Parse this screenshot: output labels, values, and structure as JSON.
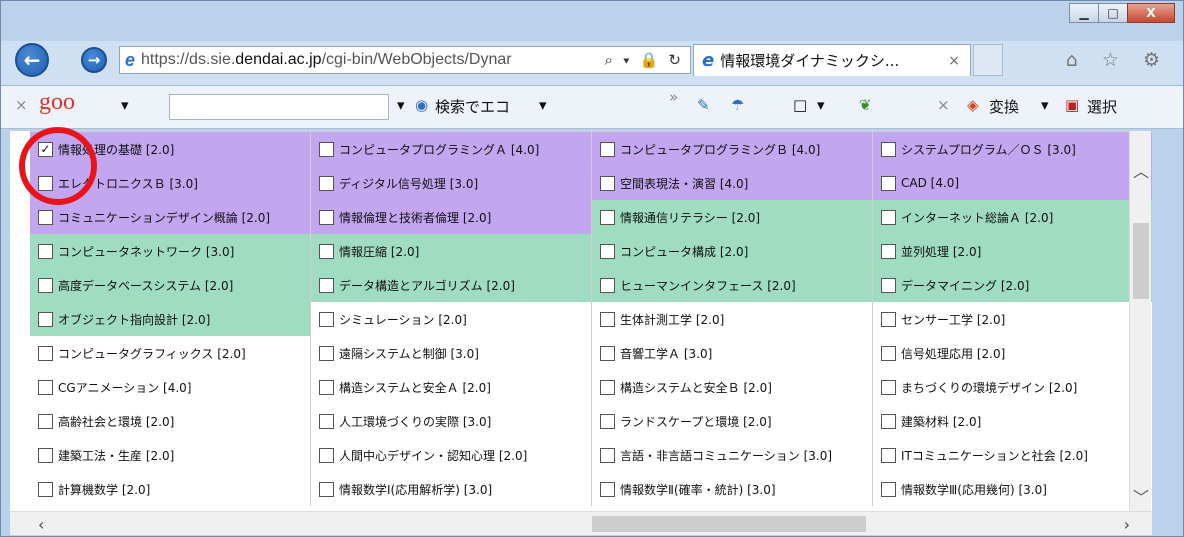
{
  "window": {
    "controls": {
      "minimize": "▁",
      "maximize": "□",
      "close": "X"
    }
  },
  "browser": {
    "address_prefix": "https://ds.sie.",
    "address_host": "dendai.ac.jp",
    "address_rest": "/cgi-bin/WebObjects/Dynar",
    "address_tools": "⌕ ▾ 🔒 ↻",
    "tab_title": "情報環境ダイナミックシ...",
    "tab_close": "×",
    "right_icons": "⌂ ☆ ⚙"
  },
  "toolbar": {
    "goo_close": "×",
    "goo_label": "goo",
    "goo_dropdown": "▾",
    "search_dropdown": "▾",
    "eco_label": "検索でエコ",
    "eco_dropdown": "▾",
    "overflow": "»",
    "page_icon_dropdown": "▾",
    "convert_close": "×",
    "convert_label": "変換",
    "convert_dropdown": "▾",
    "select_label": "選択"
  },
  "courses": {
    "rows": [
      [
        {
          "label": "情報処理の基礎 [2.0]",
          "color": "#c2a6f0",
          "checked": true
        },
        {
          "label": "コンピュータプログラミングＡ [4.0]",
          "color": "#c2a6f0",
          "checked": false
        },
        {
          "label": "コンピュータプログラミングＢ [4.0]",
          "color": "#c2a6f0",
          "checked": false
        },
        {
          "label": "システムプログラム／ＯＳ [3.0]",
          "color": "#c2a6f0",
          "checked": false
        }
      ],
      [
        {
          "label": "エレクトロニクスＢ [3.0]",
          "color": "#c2a6f0",
          "checked": false
        },
        {
          "label": "ディジタル信号処理 [3.0]",
          "color": "#c2a6f0",
          "checked": false
        },
        {
          "label": "空間表現法・演習 [4.0]",
          "color": "#c2a6f0",
          "checked": false
        },
        {
          "label": "CAD [4.0]",
          "color": "#c2a6f0",
          "checked": false
        }
      ],
      [
        {
          "label": "コミュニケーションデザイン概論 [2.0]",
          "color": "#c2a6f0",
          "checked": false
        },
        {
          "label": "情報倫理と技術者倫理 [2.0]",
          "color": "#c2a6f0",
          "checked": false
        },
        {
          "label": "情報通信リテラシー [2.0]",
          "color": "#9fdcc1",
          "checked": false
        },
        {
          "label": "インターネット総論Ａ [2.0]",
          "color": "#9fdcc1",
          "checked": false
        }
      ],
      [
        {
          "label": "コンピュータネットワーク [3.0]",
          "color": "#9fdcc1",
          "checked": false
        },
        {
          "label": "情報圧縮 [2.0]",
          "color": "#9fdcc1",
          "checked": false
        },
        {
          "label": "コンピュータ構成 [2.0]",
          "color": "#9fdcc1",
          "checked": false
        },
        {
          "label": "並列処理 [2.0]",
          "color": "#9fdcc1",
          "checked": false
        }
      ],
      [
        {
          "label": "高度データベースシステム [2.0]",
          "color": "#9fdcc1",
          "checked": false
        },
        {
          "label": "データ構造とアルゴリズム [2.0]",
          "color": "#9fdcc1",
          "checked": false
        },
        {
          "label": "ヒューマンインタフェース [2.0]",
          "color": "#9fdcc1",
          "checked": false
        },
        {
          "label": "データマイニング [2.0]",
          "color": "#9fdcc1",
          "checked": false
        }
      ],
      [
        {
          "label": "オブジェクト指向設計 [2.0]",
          "color": "#9fdcc1",
          "checked": false
        },
        {
          "label": "シミュレーション [2.0]",
          "color": "#ffffff",
          "checked": false
        },
        {
          "label": "生体計測工学 [2.0]",
          "color": "#ffffff",
          "checked": false
        },
        {
          "label": "センサー工学 [2.0]",
          "color": "#ffffff",
          "checked": false
        }
      ],
      [
        {
          "label": "コンピュータグラフィックス [2.0]",
          "color": "#ffffff",
          "checked": false
        },
        {
          "label": "遠隔システムと制御 [3.0]",
          "color": "#ffffff",
          "checked": false
        },
        {
          "label": "音響工学Ａ [3.0]",
          "color": "#ffffff",
          "checked": false
        },
        {
          "label": "信号処理応用 [2.0]",
          "color": "#ffffff",
          "checked": false
        }
      ],
      [
        {
          "label": "CGアニメーション [4.0]",
          "color": "#ffffff",
          "checked": false
        },
        {
          "label": "構造システムと安全Ａ [2.0]",
          "color": "#ffffff",
          "checked": false
        },
        {
          "label": "構造システムと安全Ｂ [2.0]",
          "color": "#ffffff",
          "checked": false
        },
        {
          "label": "まちづくりの環境デザイン [2.0]",
          "color": "#ffffff",
          "checked": false
        }
      ],
      [
        {
          "label": "高齢社会と環境 [2.0]",
          "color": "#ffffff",
          "checked": false
        },
        {
          "label": "人工環境づくりの実際 [3.0]",
          "color": "#ffffff",
          "checked": false
        },
        {
          "label": "ランドスケープと環境 [2.0]",
          "color": "#ffffff",
          "checked": false
        },
        {
          "label": "建築材料 [2.0]",
          "color": "#ffffff",
          "checked": false
        }
      ],
      [
        {
          "label": "建築工法・生産 [2.0]",
          "color": "#ffffff",
          "checked": false
        },
        {
          "label": "人間中心デザイン・認知心理 [2.0]",
          "color": "#ffffff",
          "checked": false
        },
        {
          "label": "言語・非言語コミュニケーション [3.0]",
          "color": "#ffffff",
          "checked": false
        },
        {
          "label": "ITコミュニケーションと社会 [2.0]",
          "color": "#ffffff",
          "checked": false
        }
      ],
      [
        {
          "label": "計算機数学 [2.0]",
          "color": "#ffffff",
          "checked": false
        },
        {
          "label": "情報数学Ⅰ(応用解析学) [3.0]",
          "color": "#ffffff",
          "checked": false
        },
        {
          "label": "情報数学Ⅱ(確率・統計) [3.0]",
          "color": "#ffffff",
          "checked": false
        },
        {
          "label": "情報数学Ⅲ(応用幾何) [3.0]",
          "color": "#ffffff",
          "checked": false
        }
      ]
    ]
  },
  "scroll": {
    "up": "︿",
    "down": "﹀",
    "left": "‹",
    "right": "›"
  }
}
